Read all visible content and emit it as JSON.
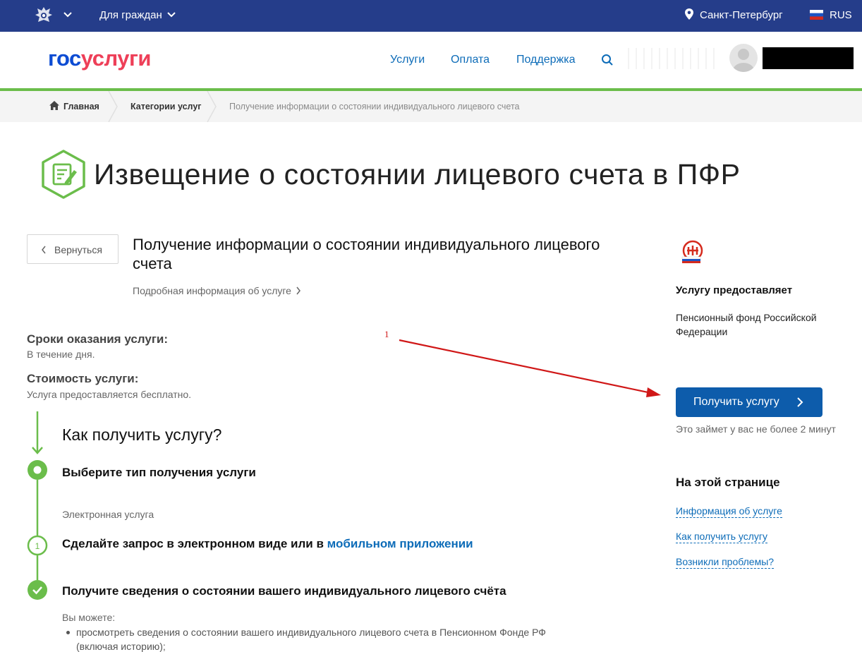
{
  "topbar": {
    "citizens_label": "Для граждан",
    "city": "Санкт-Петербург",
    "language": "RUS",
    "emblem_icon": "coat-of-arms-icon"
  },
  "header": {
    "logo_part1": "гос",
    "logo_part2": "услуги",
    "nav": [
      "Услуги",
      "Оплата",
      "Поддержка"
    ],
    "brand_colors": {
      "blue": "#0d4cd3",
      "red": "#ee3f58",
      "green": "#6bbd4b",
      "topbar": "#253d8a"
    }
  },
  "breadcrumb": {
    "home": "Главная",
    "categories": "Категории услуг",
    "current": "Получение информации о состоянии индивидуального лицевого счета"
  },
  "page": {
    "title": "Извещение о состоянии лицевого счета в ПФР",
    "back_label": "Вернуться",
    "service_title": "Получение информации о состоянии индивидуального лицевого счета",
    "details_link": "Подробная информация об услуге"
  },
  "terms": {
    "duration_heading": "Сроки оказания услуги:",
    "duration_value": "В течение дня.",
    "cost_heading": "Стоимость услуги:",
    "cost_value": "Услуга предоставляется бесплатно."
  },
  "how": {
    "title": "Как получить услугу?",
    "step1_heading": "Выберите тип получения услуги",
    "step1_sub": "Электронная услуга",
    "step2_number": "1",
    "step2_heading": "Сделайте запрос в электронном виде или в",
    "step2_link": "мобильном приложении",
    "step3_heading": "Получите сведения о состоянии вашего индивидуального лицевого счёта",
    "step3_sub": "Вы можете:",
    "bullets": [
      "просмотреть сведения о состоянии вашего индивидуального лицевого счета в Пенсионном Фонде РФ (включая историю);"
    ]
  },
  "sidebar": {
    "provider_heading": "Услугу предоставляет",
    "provider_name": "Пенсионный фонд Российской Федерации",
    "get_service_button": "Получить услугу",
    "time_note": "Это займет у вас не более 2 минут",
    "onpage_heading": "На этой странице",
    "onpage_links": [
      "Информация об услуге",
      "Как получить услугу",
      "Возникли проблемы?"
    ]
  },
  "annotation": {
    "label": "1",
    "color": "#d01717"
  }
}
